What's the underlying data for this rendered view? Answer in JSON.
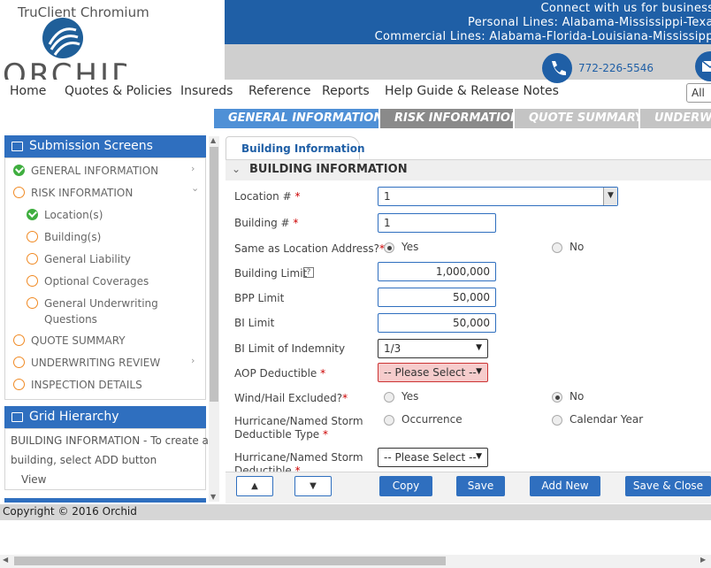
{
  "app": {
    "title": "TruClient Chromium",
    "logo_text": "ORCHID"
  },
  "banner": {
    "line1": "Connect with us for business in t",
    "line2": "Personal Lines: Alabama-Mississippi-Texas (G",
    "line3": "Commercial Lines: Alabama-Florida-Louisiana-Mississippi-Ne",
    "phone": "772-226-5546"
  },
  "nav": {
    "items": [
      "Home",
      "Quotes & Policies",
      "Insureds",
      "Reference",
      "Reports",
      "Help Guide & Release Notes"
    ],
    "search_scope": "All"
  },
  "steps": [
    "GENERAL INFORMATION",
    "RISK INFORMATION",
    "QUOTE SUMMARY",
    "UNDERWRI"
  ],
  "sidebar": {
    "submission_title": "Submission Screens",
    "items": [
      {
        "label": "GENERAL INFORMATION",
        "status": "done",
        "chevron": "›"
      },
      {
        "label": "RISK INFORMATION",
        "status": "pending",
        "chevron": "⌄"
      },
      {
        "label": "Location(s)",
        "status": "done"
      },
      {
        "label": "Building(s)",
        "status": "pending"
      },
      {
        "label": "General Liability",
        "status": "pending"
      },
      {
        "label": "Optional Coverages",
        "status": "pending"
      },
      {
        "label": "General Underwriting",
        "label2": "Questions",
        "status": "pending"
      },
      {
        "label": "QUOTE SUMMARY",
        "status": "pending"
      },
      {
        "label": "UNDERWRITING REVIEW",
        "status": "pending",
        "chevron": "›"
      },
      {
        "label": "INSPECTION DETAILS",
        "status": "pending"
      }
    ],
    "grid_title": "Grid Hierarchy",
    "grid_text_1": "BUILDING INFORMATION - To create a",
    "grid_text_2": "building, select ADD button",
    "grid_view": "View"
  },
  "form": {
    "tab": "Building Information",
    "section": "BUILDING INFORMATION",
    "location_label": "Location #",
    "location_value": "1",
    "building_label": "Building #",
    "building_value": "1",
    "same_address_label": "Same as Location Address?",
    "yes": "Yes",
    "no": "No",
    "building_limit_label": "Building Limit",
    "building_limit_value": "1,000,000",
    "bpp_label": "BPP Limit",
    "bpp_value": "50,000",
    "bi_label": "BI Limit",
    "bi_value": "50,000",
    "bi_indemnity_label": "BI Limit of Indemnity",
    "bi_indemnity_value": "1/3",
    "aop_label": "AOP Deductible",
    "aop_value": "-- Please Select --",
    "wind_label": "Wind/Hail Excluded?",
    "hurricane_type_label_1": "Hurricane/Named Storm",
    "hurricane_type_label_2": "Deductible Type",
    "occurrence": "Occurrence",
    "calendar_year": "Calendar Year",
    "hurricane_ded_label_1": "Hurricane/Named Storm",
    "hurricane_ded_label_2": "Deductible",
    "hurricane_ded_value": "-- Please Select --",
    "required_mark": "*",
    "help_mark": "?"
  },
  "toolbar": {
    "up": "▲",
    "down": "▼",
    "copy": "Copy",
    "save": "Save",
    "add_new": "Add New",
    "save_close": "Save & Close"
  },
  "footer": {
    "copyright": "Copyright © 2016 Orchid"
  },
  "colors": {
    "primary": "#2f6fbf",
    "banner": "#1f5fa6",
    "done": "#3fae3f",
    "pending": "#f08a24",
    "error_bg": "#f6cccc"
  }
}
